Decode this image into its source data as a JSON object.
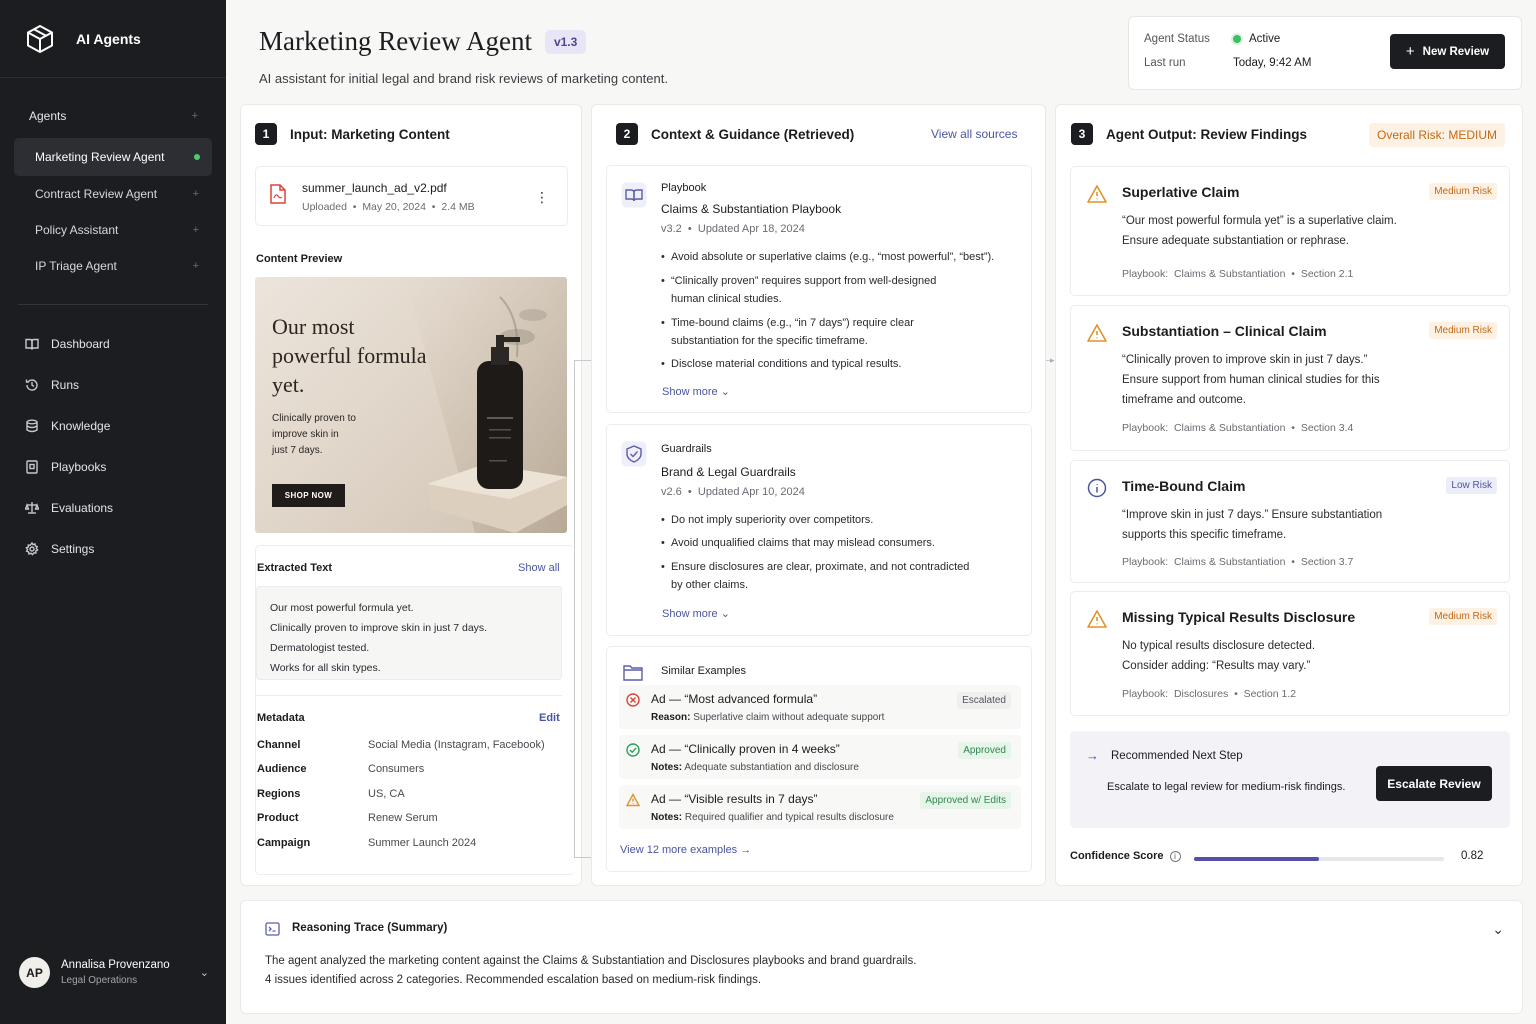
{
  "sidebar": {
    "brand": "AI Agents",
    "agents_heading": "Agents",
    "agents": [
      {
        "label": "Marketing Review Agent",
        "active": true
      },
      {
        "label": "Contract Review Agent"
      },
      {
        "label": "Policy Assistant"
      },
      {
        "label": "IP Triage Agent"
      }
    ],
    "nav": [
      {
        "label": "Dashboard",
        "icon": "book-open-icon"
      },
      {
        "label": "Runs",
        "icon": "history-icon"
      },
      {
        "label": "Knowledge",
        "icon": "database-icon"
      },
      {
        "label": "Playbooks",
        "icon": "playbook-icon"
      },
      {
        "label": "Evaluations",
        "icon": "scale-icon"
      },
      {
        "label": "Settings",
        "icon": "gear-icon"
      }
    ],
    "user": {
      "initials": "AP",
      "name": "Annalisa Provenzano",
      "role": "Legal Operations"
    }
  },
  "header": {
    "title": "Marketing Review Agent",
    "version": "v1.3",
    "subtitle": "AI assistant for initial legal and brand risk reviews of marketing content.",
    "status_label": "Agent Status",
    "status_value": "Active",
    "last_run_label": "Last run",
    "last_run_value": "Today, 9:42 AM",
    "new_review": "New Review",
    "colors": {
      "accent": "#1c1d21",
      "active": "#3fbf65",
      "badge_bg": "#e8e5f6"
    }
  },
  "input": {
    "step": "1",
    "title": "Input: Marketing Content",
    "file_name": "summer_launch_ad_v2.pdf",
    "file_uploaded": "Uploaded",
    "file_date": "May 20, 2024",
    "file_size": "2.4 MB",
    "preview_label": "Content Preview",
    "ad": {
      "headline": [
        "Our most",
        "powerful formula",
        "yet."
      ],
      "body": [
        "Clinically proven to",
        "improve skin in",
        "just 7 days."
      ],
      "cta": "SHOP NOW"
    },
    "extracted_label": "Extracted Text",
    "show_all": "Show all",
    "extracted_lines": [
      "Our most powerful formula yet.",
      "Clinically proven to improve skin in just 7 days.",
      "Dermatologist tested.",
      "Works for all skin types."
    ],
    "metadata_label": "Metadata",
    "edit": "Edit",
    "metadata": [
      {
        "key": "Channel",
        "value": "Social Media (Instagram, Facebook)"
      },
      {
        "key": "Audience",
        "value": "Consumers"
      },
      {
        "key": "Regions",
        "value": "US, CA"
      },
      {
        "key": "Product",
        "value": "Renew Serum"
      },
      {
        "key": "Campaign",
        "value": "Summer Launch 2024"
      }
    ]
  },
  "context": {
    "step": "2",
    "title": "Context & Guidance (Retrieved)",
    "view_all": "View all sources",
    "playbook": {
      "kind": "Playbook",
      "name": "Claims & Substantiation Playbook",
      "version": "v3.2",
      "updated": "Updated Apr 18, 2024",
      "bullets": [
        [
          "Avoid absolute or superlative claims (e.g., “most powerful”, “best”)."
        ],
        [
          "“Clinically proven” requires support from well-designed",
          "human clinical studies."
        ],
        [
          "Time-bound claims (e.g., “in 7 days”) require clear",
          "substantiation for the specific timeframe."
        ],
        [
          "Disclose material conditions and typical results."
        ]
      ],
      "show_more": "Show more"
    },
    "guardrails": {
      "kind": "Guardrails",
      "name": "Brand & Legal Guardrails",
      "version": "v2.6",
      "updated": "Updated Apr 10, 2024",
      "bullets": [
        [
          "Do not imply superiority over competitors."
        ],
        [
          "Avoid unqualified claims that may mislead consumers."
        ],
        [
          "Ensure disclosures are clear, proximate, and not contradicted",
          "by other claims."
        ]
      ],
      "show_more": "Show more"
    },
    "examples": {
      "title": "Similar Examples",
      "items": [
        {
          "title": "Ad — “Most advanced formula”",
          "note_label": "Reason:",
          "note": "Superlative claim without adequate support",
          "status": "Escalated"
        },
        {
          "title": "Ad — “Clinically proven in 4 weeks”",
          "note_label": "Notes:",
          "note": "Adequate substantiation and disclosure",
          "status": "Approved"
        },
        {
          "title": "Ad — “Visible results in 7 days”",
          "note_label": "Notes:",
          "note": "Required qualifier and typical results disclosure",
          "status": "Approved w/ Edits"
        }
      ],
      "view_more": "View 12 more examples"
    }
  },
  "output": {
    "step": "3",
    "title": "Agent Output: Review Findings",
    "overall_risk": "Overall Risk: MEDIUM",
    "findings": [
      {
        "title": "Superlative Claim",
        "risk": "Medium Risk",
        "body": [
          "“Our most powerful formula yet” is a superlative claim.",
          "Ensure adequate substantiation or rephrase."
        ],
        "ref_label": "Playbook:",
        "ref_doc": "Claims & Substantiation",
        "ref_section": "Section 2.1"
      },
      {
        "title": "Substantiation – Clinical Claim",
        "risk": "Medium Risk",
        "body": [
          "“Clinically proven to improve skin in just 7 days.”",
          "Ensure support from human clinical studies for this",
          "timeframe and outcome."
        ],
        "ref_label": "Playbook:",
        "ref_doc": "Claims & Substantiation",
        "ref_section": "Section 3.4"
      },
      {
        "title": "Time-Bound Claim",
        "risk": "Low Risk",
        "body": [
          "“Improve skin in just 7 days.” Ensure substantiation",
          "supports this specific timeframe."
        ],
        "ref_label": "Playbook:",
        "ref_doc": "Claims & Substantiation",
        "ref_section": "Section 3.7"
      },
      {
        "title": "Missing Typical Results Disclosure",
        "risk": "Medium Risk",
        "body": [
          "No typical results disclosure detected.",
          "Consider adding: “Results may vary.”"
        ],
        "ref_label": "Playbook:",
        "ref_doc": "Disclosures",
        "ref_section": "Section 1.2"
      }
    ],
    "next_step_label": "Recommended Next Step",
    "next_step_text": "Escalate to legal review for medium-risk findings.",
    "escalate": "Escalate Review",
    "confidence_label": "Confidence Score",
    "confidence_value": "0.82",
    "confidence": 0.5
  },
  "reasoning": {
    "title": "Reasoning Trace (Summary)",
    "lines": [
      "The agent analyzed the marketing content against the Claims & Substantiation and Disclosures playbooks and brand guardrails.",
      "4 issues identified across 2 categories. Recommended escalation based on medium-risk findings."
    ]
  }
}
